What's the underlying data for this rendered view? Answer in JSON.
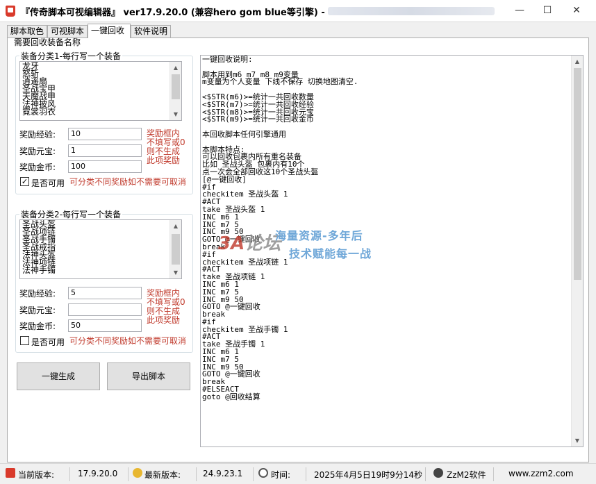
{
  "window": {
    "title": "『传奇脚本可视编辑器』  ver17.9.20.0    (兼容hero gom blue等引擎) -",
    "minimize": "—",
    "maximize": "☐",
    "close": "✕"
  },
  "tabs": [
    {
      "label": "脚本取色"
    },
    {
      "label": "可视脚本"
    },
    {
      "label": "一键回收"
    },
    {
      "label": "软件说明"
    }
  ],
  "panel": {
    "title": "需要回收装备名称"
  },
  "group1": {
    "legend": "装备分类1-每行写一个装备",
    "items": [
      "龙牙",
      "怒斩",
      "逍遥扇",
      "圣战宝甲",
      "天魔战甲",
      "法神披风",
      "霓裳羽衣"
    ],
    "exp_label": "奖励经验:",
    "exp_value": "10",
    "yuanbao_label": "奖励元宝:",
    "yuanbao_value": "1",
    "gold_label": "奖励金币:",
    "gold_value": "100",
    "note": [
      "奖励框内",
      "不填写或0",
      "则不生成",
      "此项奖励"
    ],
    "enabled_checked": true,
    "enabled_mark": "✓",
    "enabled_label": "是否可用",
    "enabled_note": "可分类不同奖励如不需要可取消"
  },
  "group2": {
    "legend": "装备分类2-每行写一个装备",
    "items": [
      "圣战头盔",
      "圣战项链",
      "圣战手镯",
      "圣战戒指",
      "法神头盔",
      "法神项链",
      "法神手镯"
    ],
    "exp_label": "奖励经验:",
    "exp_value": "5",
    "yuanbao_label": "奖励元宝:",
    "yuanbao_value": "",
    "gold_label": "奖励金币:",
    "gold_value": "50",
    "note": [
      "奖励框内",
      "不填写或0",
      "则不生成",
      "此项奖励"
    ],
    "enabled_checked": false,
    "enabled_mark": "",
    "enabled_label": "是否可用",
    "enabled_note": "可分类不同奖励如不需要可取消"
  },
  "buttons": {
    "generate": "一键生成",
    "export": "导出脚本"
  },
  "script_text": [
    "一键回收说明:",
    "",
    "脚本用到m6 m7 m8 m9变量",
    "m变量为个人变量 下线不保存 切换地图清空.",
    "",
    "<$STR(m6)>=统计一共回收数量",
    "<$STR(m7)>=统计一共回收经验",
    "<$STR(m8)>=统计一共回收元宝",
    "<$STR(m9)>=统计一共回收金币",
    "",
    "本回收脚本任何引擎通用",
    "",
    "本脚本特点:",
    "可以回收包裹内所有重名装备",
    "比如 圣战头盔 包裹内有10个",
    "点一次会全部回收这10个圣战头盔",
    "[@一键回收]",
    "#if",
    "checkitem 圣战头盔 1",
    "#ACT",
    "take 圣战头盔 1",
    "INC m6 1",
    "INC m7 5",
    "INC m9 50",
    "GOTO @一键回收",
    "break",
    "#if",
    "checkitem 圣战项链 1",
    "#ACT",
    "take 圣战项链 1",
    "INC m6 1",
    "INC m7 5",
    "INC m9 50",
    "GOTO @一键回收",
    "break",
    "#if",
    "checkitem 圣战手镯 1",
    "#ACT",
    "take 圣战手镯 1",
    "INC m6 1",
    "INC m7 5",
    "INC m9 50",
    "GOTO @一键回收",
    "break",
    "#ELSEACT",
    "goto @回收结算"
  ],
  "watermark": {
    "logo_main": "3A",
    "logo_sub": "论坛",
    "line1": "海量资源-多年后",
    "line2": "技术赋能每一战"
  },
  "statusbar": {
    "current_label": "当前版本:",
    "current_value": "17.9.20.0",
    "latest_label": "最新版本:",
    "latest_value": "24.9.23.1",
    "time_label": "时间:",
    "time_value": "2025年4月5日19时9分14秒",
    "brand": "ZzM2软件",
    "website": "www.zzm2.com"
  },
  "colors": {
    "red_note": "#c0392b",
    "watermark_blue": "#6fa7d8"
  }
}
